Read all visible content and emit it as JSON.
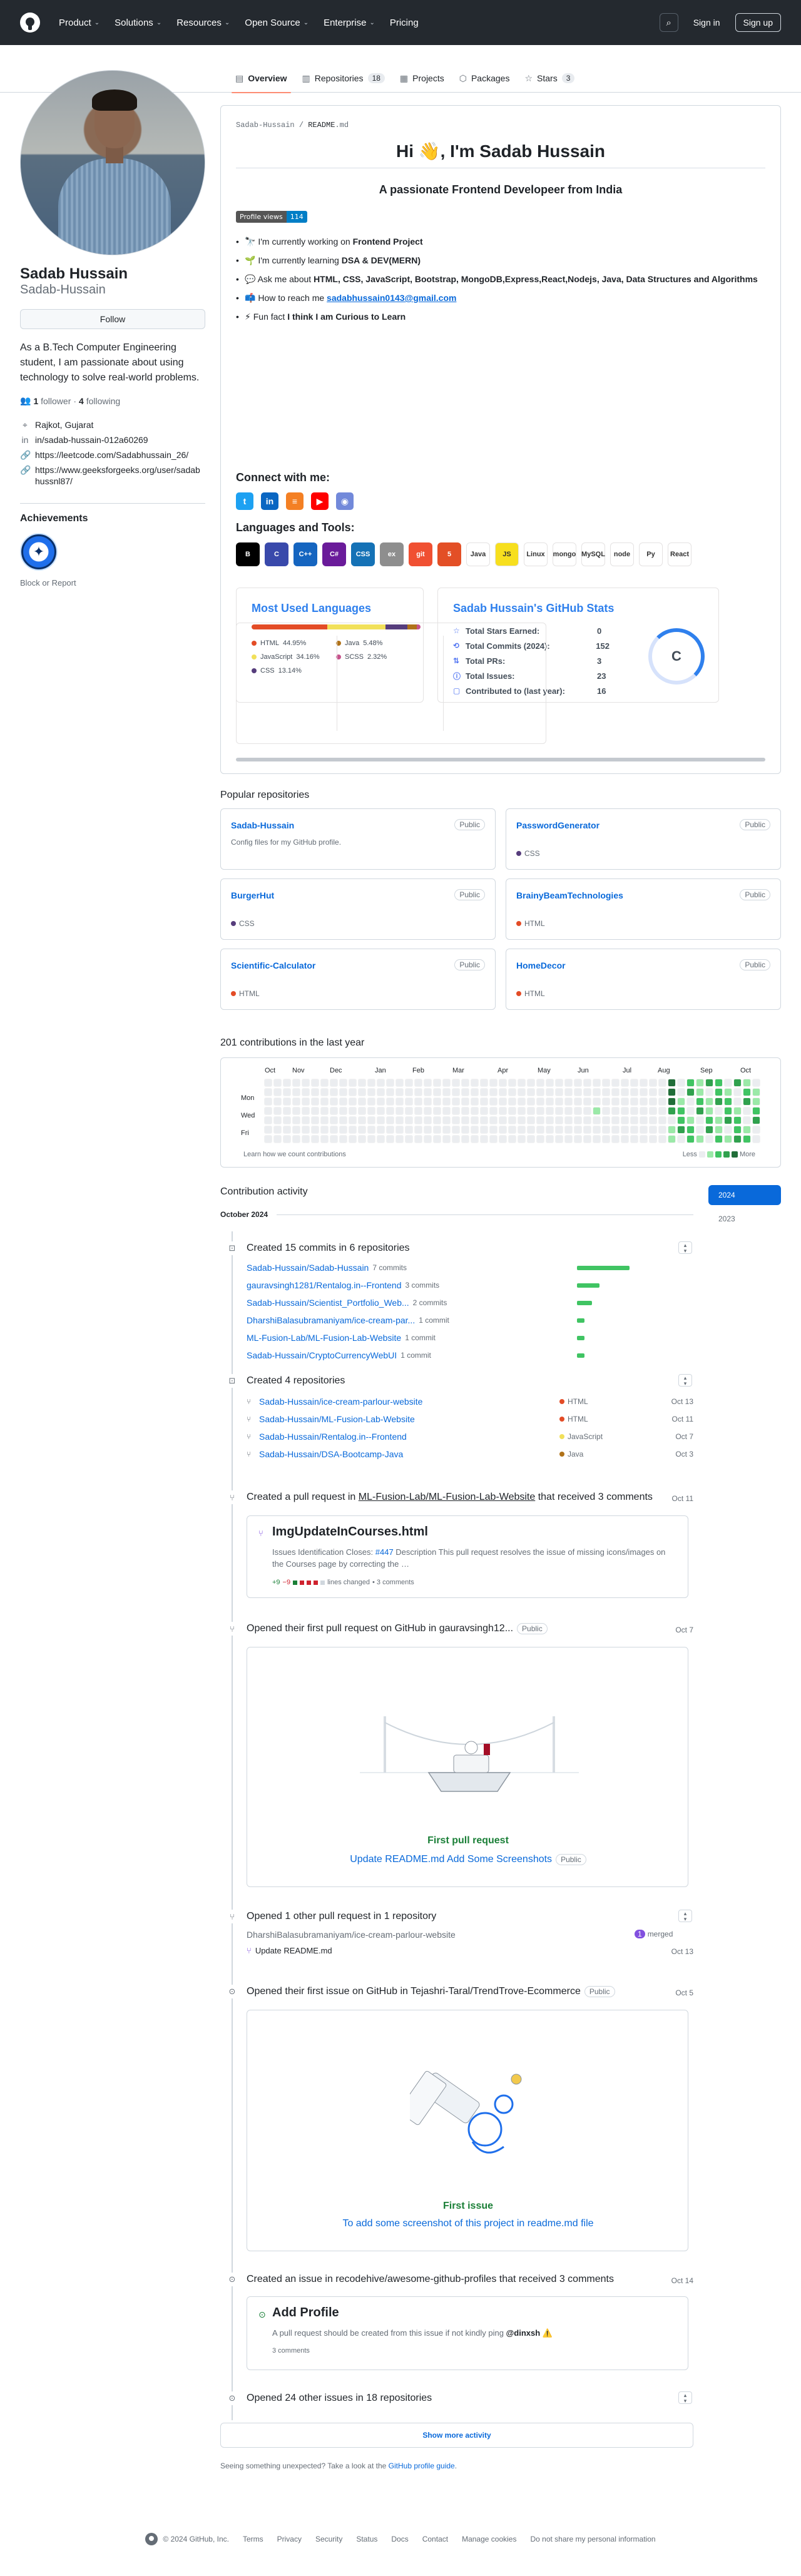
{
  "header": {
    "nav": [
      "Product",
      "Solutions",
      "Resources",
      "Open Source",
      "Enterprise",
      "Pricing"
    ],
    "sign_in": "Sign in",
    "sign_up": "Sign up"
  },
  "tabs": [
    {
      "label": "Overview",
      "count": ""
    },
    {
      "label": "Repositories",
      "count": "18"
    },
    {
      "label": "Projects",
      "count": ""
    },
    {
      "label": "Packages",
      "count": ""
    },
    {
      "label": "Stars",
      "count": "3"
    }
  ],
  "profile": {
    "name": "Sadab Hussain",
    "login": "Sadab-Hussain",
    "follow": "Follow",
    "bio": "As a B.Tech Computer Engineering student, I am passionate about using technology to solve real-world problems.",
    "followers_count": "1",
    "followers_label": "follower",
    "following_count": "4",
    "following_label": "following",
    "location": "Rajkot, Gujarat",
    "linkedin": "in/sadab-hussain-012a60269",
    "leetcode": "https://leetcode.com/Sadabhussain_26/",
    "gfg": "https://www.geeksforgeeks.org/user/sadabhussnl87/",
    "achievements_title": "Achievements",
    "block_report": "Block or Report"
  },
  "readme": {
    "path_user": "Sadab-Hussain",
    "path_sep": " / ",
    "path_file": "README",
    "path_ext": ".md",
    "title": "Hi 👋, I'm Sadab Hussain",
    "subtitle": "A passionate Frontend Developeer from India",
    "views_label": "Profile views",
    "views_count": "114",
    "bullets": [
      {
        "icon": "🔭",
        "pre": "I'm currently working on ",
        "bold": "Frontend Project"
      },
      {
        "icon": "🌱",
        "pre": "I'm currently learning ",
        "bold": "DSA & DEV(MERN)"
      },
      {
        "icon": "💬",
        "pre": "Ask me about ",
        "bold": "HTML, CSS, JavaScript, Bootstrap, MongoDB,Express,React,Nodejs, Java, Data Structures and Algorithms"
      },
      {
        "icon": "📫",
        "pre": "How to reach me ",
        "link": "sadabhussain0143@gmail.com"
      },
      {
        "icon": "⚡",
        "pre": "Fun fact ",
        "bold": "I think I am Curious to Learn"
      }
    ],
    "connect_title": "Connect with me:",
    "social": [
      "twitter-icon",
      "linkedin-icon",
      "stackoverflow-icon",
      "youtube-icon",
      "discord-icon"
    ],
    "tools_title": "Languages and Tools:",
    "tools": [
      {
        "label": "B",
        "color": "#000000"
      },
      {
        "label": "C",
        "color": "#3949ab"
      },
      {
        "label": "C++",
        "color": "#1565c0"
      },
      {
        "label": "C#",
        "color": "#6a1b9a"
      },
      {
        "label": "CSS",
        "color": "#1572b6"
      },
      {
        "label": "ex",
        "color": "#8e8e8e"
      },
      {
        "label": "git",
        "color": "#f05032"
      },
      {
        "label": "5",
        "color": "#e34f26"
      },
      {
        "label": "Java",
        "color": "#ffffff"
      },
      {
        "label": "JS",
        "color": "#f7df1e"
      },
      {
        "label": "Linux",
        "color": "#ffffff"
      },
      {
        "label": "mongo",
        "color": "#ffffff"
      },
      {
        "label": "MySQL",
        "color": "#ffffff"
      },
      {
        "label": "node",
        "color": "#ffffff"
      },
      {
        "label": "Py",
        "color": "#ffffff"
      },
      {
        "label": "React",
        "color": "#ffffff"
      }
    ],
    "langs_card": {
      "title": "Most Used Languages",
      "items": [
        {
          "name": "HTML",
          "pct": "44.95%",
          "value": 44.95,
          "color": "#e34c26"
        },
        {
          "name": "Java",
          "pct": "5.48%",
          "value": 5.48,
          "color": "#b07219"
        },
        {
          "name": "JavaScript",
          "pct": "34.16%",
          "value": 34.16,
          "color": "#f1e05a"
        },
        {
          "name": "SCSS",
          "pct": "2.32%",
          "value": 2.32,
          "color": "#c6538c"
        },
        {
          "name": "CSS",
          "pct": "13.14%",
          "value": 13.14,
          "color": "#563d7c"
        }
      ]
    },
    "stats_card": {
      "title": "Sadab Hussain's GitHub Stats",
      "rows": [
        {
          "icon": "☆",
          "label": "Total Stars Earned:",
          "value": "0"
        },
        {
          "icon": "⟲",
          "label": "Total Commits (2024):",
          "value": "152"
        },
        {
          "icon": "⇅",
          "label": "Total PRs:",
          "value": "3"
        },
        {
          "icon": "ⓘ",
          "label": "Total Issues:",
          "value": "23"
        },
        {
          "icon": "▢",
          "label": "Contributed to (last year):",
          "value": "16"
        }
      ],
      "grade": "C"
    }
  },
  "popular": {
    "title": "Popular repositories",
    "repos": [
      {
        "name": "Sadab-Hussain",
        "vis": "Public",
        "desc": "Config files for my GitHub profile.",
        "lang": "",
        "lang_color": ""
      },
      {
        "name": "PasswordGenerator",
        "vis": "Public",
        "desc": "",
        "lang": "CSS",
        "lang_color": "#563d7c"
      },
      {
        "name": "BurgerHut",
        "vis": "Public",
        "desc": "",
        "lang": "CSS",
        "lang_color": "#563d7c"
      },
      {
        "name": "BrainyBeamTechnologies",
        "vis": "Public",
        "desc": "",
        "lang": "HTML",
        "lang_color": "#e34c26"
      },
      {
        "name": "Scientific-Calculator",
        "vis": "Public",
        "desc": "",
        "lang": "HTML",
        "lang_color": "#e34c26"
      },
      {
        "name": "HomeDecor",
        "vis": "Public",
        "desc": "",
        "lang": "HTML",
        "lang_color": "#e34c26"
      }
    ]
  },
  "contributions": {
    "title": "201 contributions in the last year",
    "months": [
      "Oct",
      "Nov",
      "Dec",
      "Jan",
      "Feb",
      "Mar",
      "Apr",
      "May",
      "Jun",
      "Jul",
      "Aug",
      "Sep",
      "Oct"
    ],
    "days": [
      "Mon",
      "Wed",
      "Fri"
    ],
    "learn": "Learn how we count contributions",
    "less": "Less",
    "more": "More",
    "levels": [
      "#ebedf0",
      "#9be9a8",
      "#40c463",
      "#30a14e",
      "#216e39"
    ]
  },
  "activity": {
    "title": "Contribution activity",
    "years": [
      "2024",
      "2023"
    ],
    "month": "October 2024",
    "commits": {
      "title": "Created 15 commits in 6 repositories",
      "rows": [
        {
          "repo": "Sadab-Hussain/Sadab-Hussain",
          "count": "7 commits",
          "share": 7
        },
        {
          "repo": "gauravsingh1281/Rentalog.in--Frontend",
          "count": "3 commits",
          "share": 3
        },
        {
          "repo": "Sadab-Hussain/Scientist_Portfolio_Web...",
          "count": "2 commits",
          "share": 2
        },
        {
          "repo": "DharshiBalasubramaniyam/ice-cream-par...",
          "count": "1 commit",
          "share": 1
        },
        {
          "repo": "ML-Fusion-Lab/ML-Fusion-Lab-Website",
          "count": "1 commit",
          "share": 1
        },
        {
          "repo": "Sadab-Hussain/CryptoCurrencyWebUI",
          "count": "1 commit",
          "share": 1
        }
      ]
    },
    "repos_created": {
      "title": "Created 4 repositories",
      "rows": [
        {
          "repo": "Sadab-Hussain/ice-cream-parlour-website",
          "lang": "HTML",
          "color": "#e34c26",
          "date": "Oct 13"
        },
        {
          "repo": "Sadab-Hussain/ML-Fusion-Lab-Website",
          "lang": "HTML",
          "color": "#e34c26",
          "date": "Oct 11"
        },
        {
          "repo": "Sadab-Hussain/Rentalog.in--Frontend",
          "lang": "JavaScript",
          "color": "#f1e05a",
          "date": "Oct 7"
        },
        {
          "repo": "Sadab-Hussain/DSA-Bootcamp-Java",
          "lang": "Java",
          "color": "#b07219",
          "date": "Oct 3"
        }
      ]
    },
    "pr_event": {
      "pre": "Created a pull request in ",
      "repo": "ML-Fusion-Lab/ML-Fusion-Lab-Website",
      "post": " that received 3 comments",
      "date": "Oct 11",
      "pr_title": "ImgUpdateInCourses.html",
      "pr_body_pre": "Issues Identification Closes: ",
      "pr_link": "#447",
      "pr_body_post": " Description This pull request resolves the issue of missing icons/images on the Courses page by correcting the …",
      "diff_plus": "+9",
      "diff_minus": "−9",
      "diff_text": "lines changed",
      "comments": "• 3 comments"
    },
    "first_pr": {
      "title": "Opened their first pull request on GitHub in gauravsingh12...",
      "vis": "Public",
      "date": "Oct 7",
      "caption": "First pull request",
      "link": "Update README.md Add Some Screenshots",
      "link_vis": "Public"
    },
    "other_pr": {
      "title": "Opened 1 other pull request in 1 repository",
      "repo": "DharshiBalasubramaniyam/ice-cream-parlour-website",
      "merged": "1",
      "merged_label": "merged",
      "pr": "Update README.md",
      "date": "Oct 13"
    },
    "first_issue": {
      "title": "Opened their first issue on GitHub in Tejashri-Taral/TrendTrove-Ecommerce",
      "vis": "Public",
      "date": "Oct 5",
      "caption": "First issue",
      "link": "To add some screenshot of this project in readme.md file"
    },
    "issue_event": {
      "title": "Created an issue in recodehive/awesome-github-profiles that received 3 comments",
      "date": "Oct 14",
      "issue_title": "Add Profile",
      "issue_body_pre": "A pull request should be created from this issue if not kindly ping ",
      "issue_mention": "@dinxsh",
      "issue_emoji": "⚠️",
      "comments": "3 comments"
    },
    "other_issues": "Opened 24 other issues in 18 repositories",
    "show_more": "Show more activity",
    "seeing_pre": "Seeing something unexpected? Take a look at the ",
    "seeing_link": "GitHub profile guide",
    "seeing_post": "."
  },
  "footer": {
    "copyright": "© 2024 GitHub, Inc.",
    "links": [
      "Terms",
      "Privacy",
      "Security",
      "Status",
      "Docs",
      "Contact",
      "Manage cookies",
      "Do not share my personal information"
    ]
  }
}
